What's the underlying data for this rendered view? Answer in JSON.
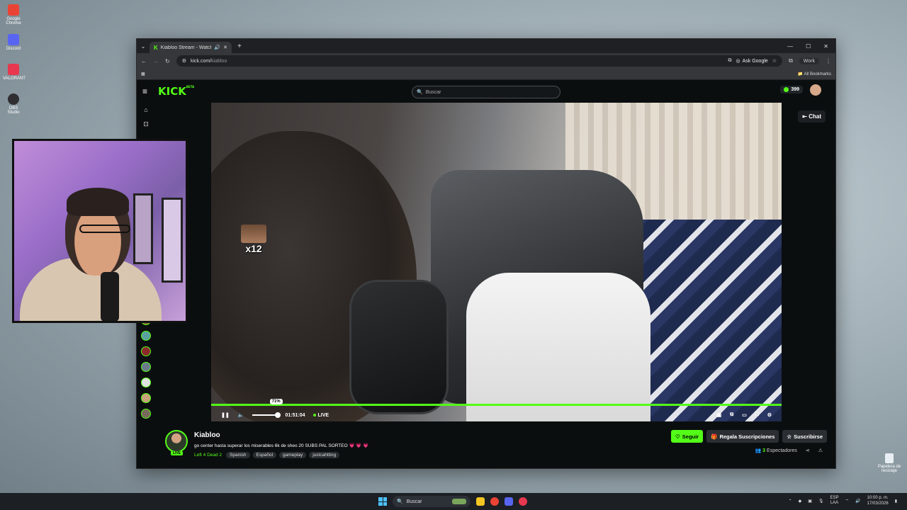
{
  "desktop": {
    "icons": [
      {
        "label": "Google Chrome",
        "color": "#ea4335"
      },
      {
        "label": "Discord",
        "color": "#5865f2"
      },
      {
        "label": "VALORANT",
        "color": "#e8384f"
      },
      {
        "label": "OBS Studio",
        "color": "#302e31"
      }
    ],
    "recycle_bin": "Papelera de reciclaje"
  },
  "browser": {
    "tab_title": "Kiabloo Stream - Watch Li...",
    "tab_plus": "+",
    "url_host": "kick.com/",
    "url_path": "kiabloo",
    "ask_google": "Ask Google",
    "profile": "Work",
    "all_bookmarks": "All Bookmarks"
  },
  "kick": {
    "logo": "KICK",
    "logo_badge": "BETA",
    "search_placeholder": "Buscar",
    "points": "399",
    "chat_label": "Chat",
    "accent": "#53fc18"
  },
  "player": {
    "emote_count": "x12",
    "volume_percent": "71%",
    "volume": 0.71,
    "time": "01:51:04",
    "live_label": "LIVE"
  },
  "channel": {
    "name": "Kiabloo",
    "live_badge": "LIVE",
    "title": "go center hasta superar los miserables 6k de sheo 20 SUBS PAL SORTEO",
    "title_hearts": "💗 💗 💗",
    "category": "Left 4 Dead 2",
    "tags": [
      "Spanish",
      "Español",
      "gameplay",
      "justcahtting"
    ],
    "follow_label": "Seguir",
    "gift_label": "Regala Suscripciones",
    "subscribe_label": "Suscribirse",
    "viewers_count": "3",
    "viewers_label": "Espectadores"
  },
  "taskbar": {
    "search_placeholder": "Buscar",
    "lang_top": "ESP",
    "lang_bottom": "LAA",
    "time": "10:00 p. m.",
    "date": "17/03/2026"
  }
}
